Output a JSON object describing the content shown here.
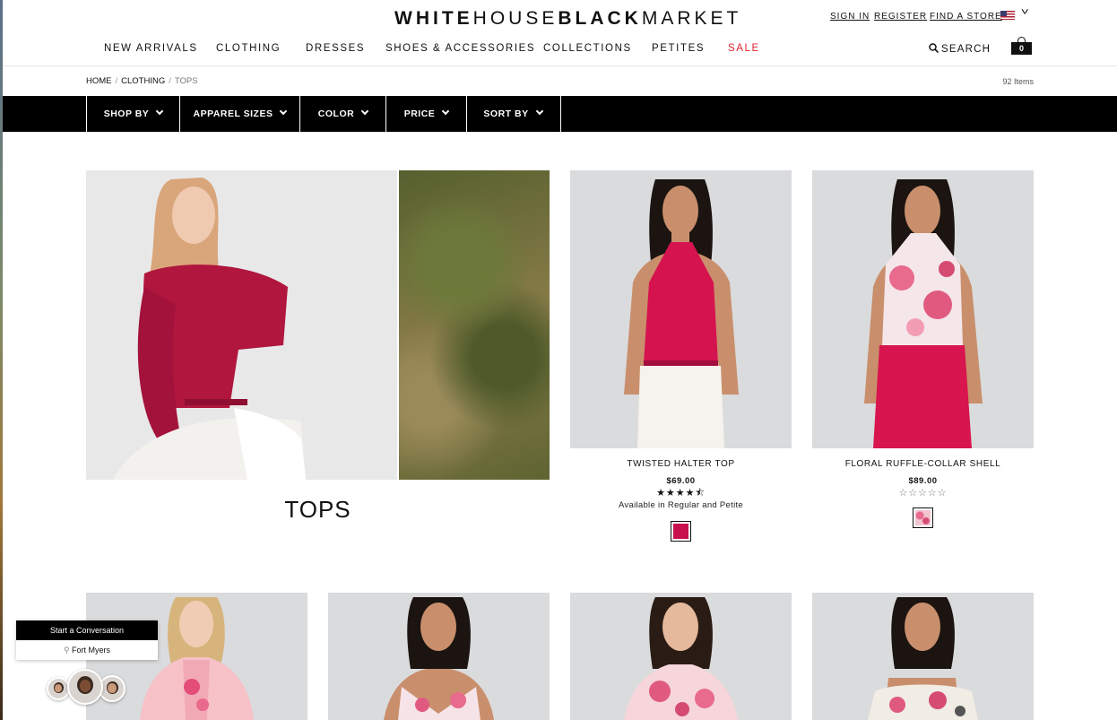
{
  "brand": {
    "part1": "WHITE",
    "part2": "HOUSE",
    "part3": "BLACK",
    "part4": "MARKET"
  },
  "utility": {
    "sign_in": "SIGN IN",
    "register": "REGISTER",
    "find_store": "FIND A STORE"
  },
  "nav": {
    "items": [
      "NEW ARRIVALS",
      "CLOTHING",
      "DRESSES",
      "SHOES & ACCESSORIES",
      "COLLECTIONS",
      "PETITES",
      "SALE"
    ],
    "search": "SEARCH",
    "bag_count": "0"
  },
  "breadcrumb": {
    "home": "HOME",
    "clothing": "CLOTHING",
    "current": "TOPS",
    "separator": "/"
  },
  "item_count": "92 Items",
  "filters": [
    "SHOP BY",
    "APPAREL SIZES",
    "COLOR",
    "PRICE",
    "SORT BY"
  ],
  "hero": {
    "title": "TOPS"
  },
  "products": [
    {
      "name": "TWISTED HALTER TOP",
      "price": "$69.00",
      "stars": "★★★★⯪",
      "rating": 4.5,
      "availability": "Available in Regular and Petite",
      "swatch_color": "#c8104e"
    },
    {
      "name": "FLORAL RUFFLE-COLLAR SHELL",
      "price": "$89.00",
      "stars": "☆☆☆☆☆",
      "rating": 0,
      "swatch_color": "#f2c4cf"
    }
  ],
  "chat": {
    "cta": "Start a Conversation",
    "location": "Fort Myers"
  },
  "colors": {
    "sale": "#e2232c",
    "filter_bar": "#000000",
    "accent_red": "#c8104e"
  }
}
